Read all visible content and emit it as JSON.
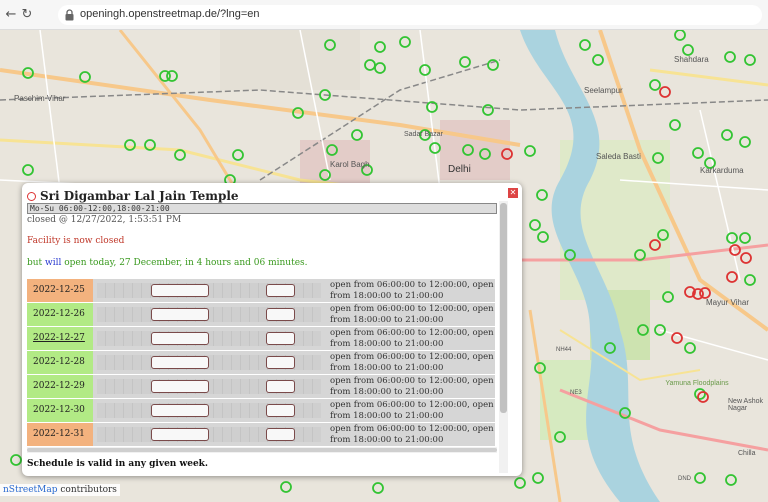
{
  "browser": {
    "url": "openingh.openstreetmap.de/?lng=en",
    "back_icon": "back-arrow-icon",
    "forward_icon": "forward-arrow-icon",
    "reload_icon": "reload-icon",
    "lock_icon": "lock-icon"
  },
  "map": {
    "labels": {
      "paschim_vihar": "Paschim Vihar",
      "karol_bagh": "Karol Bagh",
      "delhi": "Delhi",
      "sadar_bazar": "Sadar Bazar",
      "seelampur": "Seelampur",
      "shahdara": "Shahdara",
      "saleda_basti": "Saleda Basti",
      "karkarduma": "Karkarduma",
      "mayur_vihar": "Mayur Vihar",
      "yamuna_floodplains": "Yamuna Floodplains",
      "nh44": "NH44",
      "ne3": "NE3",
      "dnd": "DND",
      "new_ashok_nagar": "New Ashok Nagar",
      "chilla": "Chilla"
    },
    "attribution": {
      "link": "nStreetMap",
      "suffix": " contributors"
    }
  },
  "popup": {
    "close_icon": "close-icon",
    "title": "Sri Digambar Lal Jain Temple",
    "opening_hours": "Mo-Su 06:00-12:00,18:00-21:00",
    "closed_at": "closed @ 12/27/2022, 1:53:51 PM",
    "status": "Facility is now closed",
    "open_prefix": "but ",
    "open_will": "will",
    "open_suffix": " open today, 27 December, in 4 hours and 06 minutes.",
    "rows": [
      {
        "date": "2022-12-25",
        "text": "open from 06:00:00 to 12:00:00, open from 18:00:00 to 21:00:00"
      },
      {
        "date": "2022-12-26",
        "text": "open from 06:00:00 to 12:00:00, open from 18:00:00 to 21:00:00"
      },
      {
        "date": "2022-12-27",
        "text": "open from 06:00:00 to 12:00:00, open from 18:00:00 to 21:00:00"
      },
      {
        "date": "2022-12-28",
        "text": "open from 06:00:00 to 12:00:00, open from 18:00:00 to 21:00:00"
      },
      {
        "date": "2022-12-29",
        "text": "open from 06:00:00 to 12:00:00, open from 18:00:00 to 21:00:00"
      },
      {
        "date": "2022-12-30",
        "text": "open from 06:00:00 to 12:00:00, open from 18:00:00 to 21:00:00"
      },
      {
        "date": "2022-12-31",
        "text": "open from 06:00:00 to 12:00:00, open from 18:00:00 to 21:00:00"
      }
    ],
    "schedule_note": "Schedule is valid in any given week.",
    "colors": {
      "weekend_date": "#f3b27e",
      "weekday_date": "#b2ea85",
      "closed_text": "#c0392b",
      "open_text": "#3a9a1f"
    }
  }
}
